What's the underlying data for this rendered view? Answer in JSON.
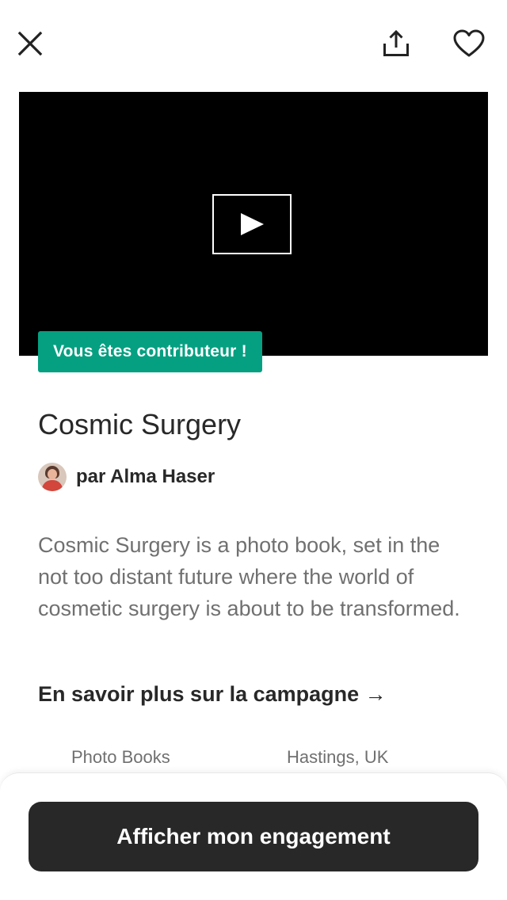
{
  "header": {
    "close_icon": "close-icon",
    "share_icon": "share-icon",
    "favorite_icon": "heart-icon"
  },
  "video": {
    "play_icon": "play-icon"
  },
  "badge": {
    "label": "Vous êtes contributeur !",
    "color": "#05a081"
  },
  "project": {
    "title": "Cosmic Surgery",
    "author": "par Alma Haser",
    "description": "Cosmic Surgery is a photo book, set in the not too distant future where the world of cosmetic surgery is about to be transformed.",
    "learn_more": "En savoir plus sur la campagne →",
    "category": "Photo Books",
    "location": "Hastings, UK"
  },
  "footer": {
    "cta_label": "Afficher mon engagement",
    "cta_color": "#282828"
  }
}
